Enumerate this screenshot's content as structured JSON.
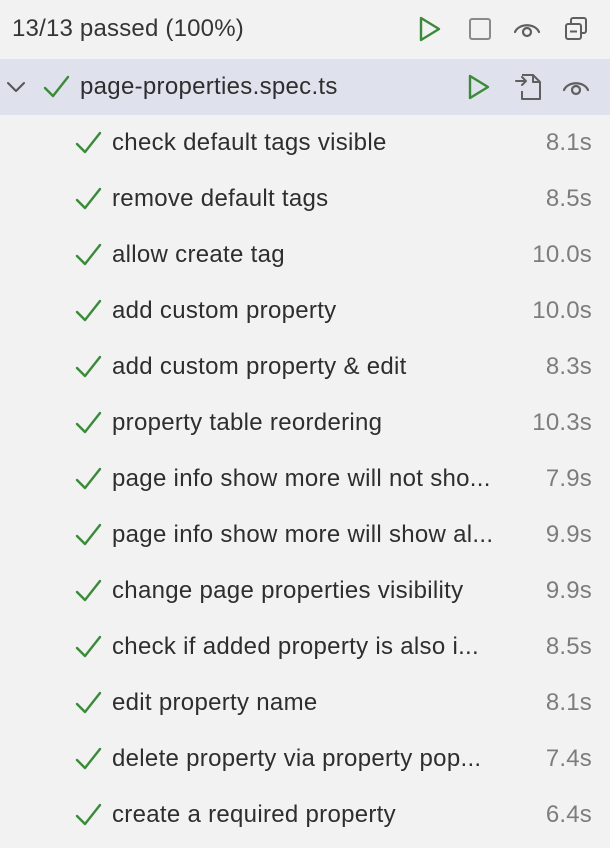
{
  "header": {
    "summary": "13/13 passed (100%)"
  },
  "suite": {
    "name": "page-properties.spec.ts"
  },
  "tests": [
    {
      "name": "check default tags visible",
      "duration": "8.1s"
    },
    {
      "name": "remove default tags",
      "duration": "8.5s"
    },
    {
      "name": "allow create tag",
      "duration": "10.0s"
    },
    {
      "name": "add custom property",
      "duration": "10.0s"
    },
    {
      "name": "add custom property & edit",
      "duration": "8.3s"
    },
    {
      "name": "property table reordering",
      "duration": "10.3s"
    },
    {
      "name": "page info show more will not sho...",
      "duration": "7.9s"
    },
    {
      "name": "page info show more will show al...",
      "duration": "9.9s"
    },
    {
      "name": "change page properties visibility",
      "duration": "9.9s"
    },
    {
      "name": "check if added property is also i...",
      "duration": "8.5s"
    },
    {
      "name": "edit property name",
      "duration": "8.1s"
    },
    {
      "name": "delete property via property pop...",
      "duration": "7.4s"
    },
    {
      "name": "create a required property",
      "duration": "6.4s"
    }
  ],
  "colors": {
    "pass": "#3a8a3a",
    "icon": "#5f5f5f",
    "selected_row": "#dfe1ec"
  },
  "icons": {
    "run": "play-icon",
    "stop": "stop-icon",
    "watch": "eye-icon",
    "collapse": "collapse-all-icon",
    "open": "open-file-icon",
    "expand": "chevron-down-icon",
    "passed": "check-icon"
  }
}
